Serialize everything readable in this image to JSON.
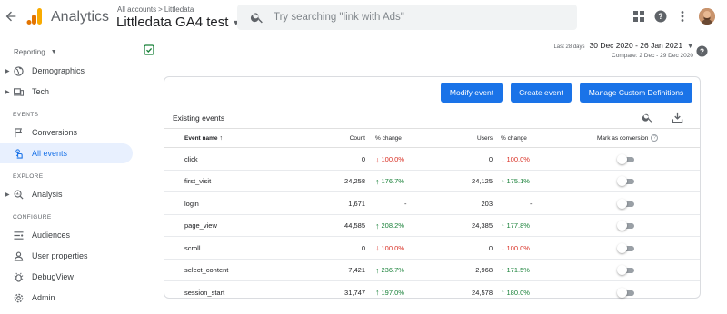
{
  "header": {
    "app_name": "Analytics",
    "breadcrumb": {
      "all_accounts": "All accounts",
      "separator": ">",
      "account": "Littledata"
    },
    "property": "Littledata GA4 test",
    "search_placeholder": "Try searching \"link with Ads\"",
    "icons": [
      "back-arrow-icon",
      "analytics-logo",
      "search-icon",
      "apps-grid-icon",
      "help-icon",
      "more-vert-icon"
    ]
  },
  "sidebar": {
    "reporting_label": "Reporting",
    "top_items": [
      {
        "label": "Demographics",
        "icon": "globe-icon"
      },
      {
        "label": "Tech",
        "icon": "devices-icon"
      }
    ],
    "events_section": "EVENTS",
    "events_items": [
      {
        "label": "Conversions",
        "icon": "flag-icon"
      },
      {
        "label": "All events",
        "icon": "touch-icon",
        "active": true
      }
    ],
    "explore_section": "EXPLORE",
    "explore_items": [
      {
        "label": "Analysis",
        "icon": "analysis-icon"
      }
    ],
    "configure_section": "CONFIGURE",
    "configure_items": [
      {
        "label": "Audiences",
        "icon": "audiences-icon"
      },
      {
        "label": "User properties",
        "icon": "user-properties-icon"
      },
      {
        "label": "DebugView",
        "icon": "debug-icon"
      },
      {
        "label": "Admin",
        "icon": "gear-icon"
      }
    ]
  },
  "date": {
    "tag": "Last 28 days",
    "range": "30 Dec 2020 - 26 Jan 2021",
    "compare": "Compare: 2 Dec - 29 Dec 2020"
  },
  "actions": {
    "modify": "Modify event",
    "create": "Create event",
    "manage": "Manage Custom Definitions"
  },
  "table": {
    "title": "Existing events",
    "headers": {
      "name": "Event name",
      "count": "Count",
      "pct1": "% change",
      "users": "Users",
      "pct2": "% change",
      "mark": "Mark as conversion"
    },
    "rows": [
      {
        "name": "click",
        "count": "0",
        "count_dir": "down",
        "count_pct": "100.0%",
        "users": "0",
        "users_dir": "down",
        "users_pct": "100.0%",
        "conversion": false
      },
      {
        "name": "first_visit",
        "count": "24,258",
        "count_dir": "up",
        "count_pct": "176.7%",
        "users": "24,125",
        "users_dir": "up",
        "users_pct": "175.1%",
        "conversion": false
      },
      {
        "name": "login",
        "count": "1,671",
        "count_dir": "none",
        "count_pct": "-",
        "users": "203",
        "users_dir": "none",
        "users_pct": "-",
        "conversion": false
      },
      {
        "name": "page_view",
        "count": "44,585",
        "count_dir": "up",
        "count_pct": "208.2%",
        "users": "24,385",
        "users_dir": "up",
        "users_pct": "177.8%",
        "conversion": false
      },
      {
        "name": "scroll",
        "count": "0",
        "count_dir": "down",
        "count_pct": "100.0%",
        "users": "0",
        "users_dir": "down",
        "users_pct": "100.0%",
        "conversion": false
      },
      {
        "name": "select_content",
        "count": "7,421",
        "count_dir": "up",
        "count_pct": "236.7%",
        "users": "2,968",
        "users_dir": "up",
        "users_pct": "171.5%",
        "conversion": false
      },
      {
        "name": "session_start",
        "count": "31,747",
        "count_dir": "up",
        "count_pct": "197.0%",
        "users": "24,578",
        "users_dir": "up",
        "users_pct": "180.0%",
        "conversion": false
      }
    ]
  },
  "colors": {
    "accent": "#1a73e8",
    "active_nav_bg": "#e8f0fe",
    "up": "#188038",
    "down": "#d93025",
    "logo_orange": "#f9ab00",
    "logo_dark_orange": "#e37400"
  }
}
